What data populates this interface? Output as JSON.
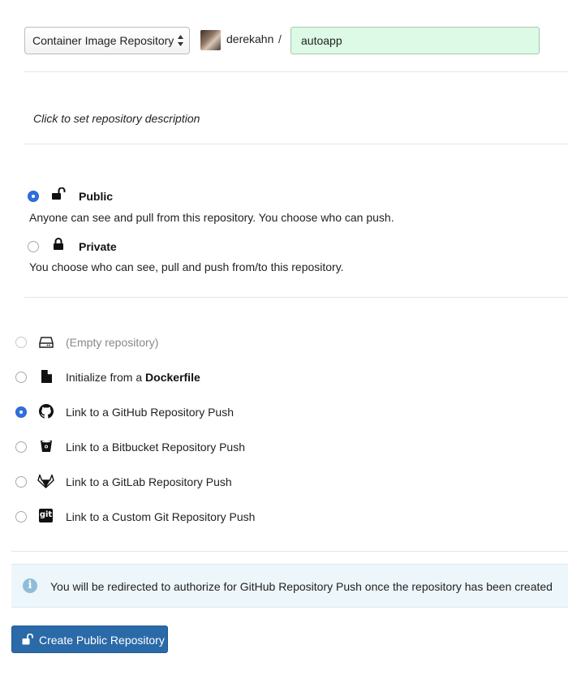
{
  "header": {
    "repo_kind_selected": "Container Image Repository",
    "namespace": "derekahn",
    "separator": "/",
    "repo_name": "autoapp"
  },
  "description": {
    "placeholder_text": "Click to set repository description"
  },
  "visibility": {
    "selected": "public",
    "options": [
      {
        "id": "public",
        "title": "Public",
        "description": "Anyone can see and pull from this repository. You choose who can push.",
        "icon": "unlock-icon"
      },
      {
        "id": "private",
        "title": "Private",
        "description": "You choose who can see, pull and push from/to this repository.",
        "icon": "lock-icon"
      }
    ]
  },
  "init_options": {
    "selected": "github",
    "items": [
      {
        "id": "empty",
        "label": "(Empty repository)",
        "icon": "hard-drive-icon"
      },
      {
        "id": "dockerfile",
        "label_prefix": "Initialize from a ",
        "label_bold": "Dockerfile",
        "icon": "file-icon"
      },
      {
        "id": "github",
        "label": "Link to a GitHub Repository Push",
        "icon": "github-icon"
      },
      {
        "id": "bitbucket",
        "label": "Link to a Bitbucket Repository Push",
        "icon": "bitbucket-icon"
      },
      {
        "id": "gitlab",
        "label": "Link to a GitLab Repository Push",
        "icon": "gitlab-icon"
      },
      {
        "id": "custom",
        "label": "Link to a Custom Git Repository Push",
        "icon": "git-icon"
      }
    ]
  },
  "info": {
    "text": "You will be redirected to authorize for GitHub Repository Push once the repository has been created",
    "icon": "info-icon"
  },
  "create_button": {
    "label": "Create Public Repository",
    "icon": "unlock-icon"
  },
  "colors": {
    "radio_checked": "#2f6fe0",
    "repo_input_bg": "#dcfae6",
    "info_bg": "#edf6fb",
    "button_bg": "#2a6aa8"
  }
}
